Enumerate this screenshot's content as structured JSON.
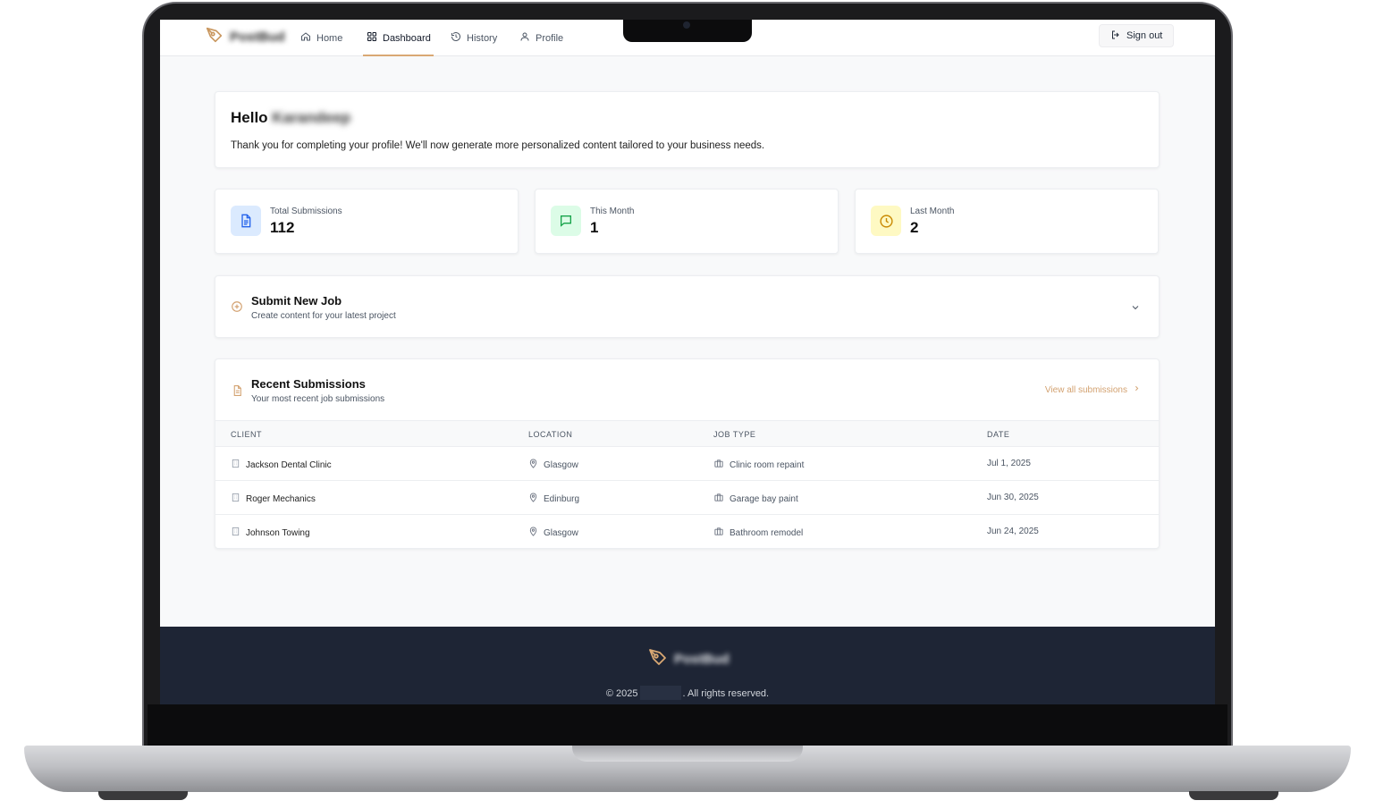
{
  "nav": {
    "brand": "PostBud",
    "items": [
      {
        "label": "Home",
        "icon": "home-icon"
      },
      {
        "label": "Dashboard",
        "icon": "grid-icon",
        "active": true
      },
      {
        "label": "History",
        "icon": "history-icon"
      },
      {
        "label": "Profile",
        "icon": "user-icon"
      }
    ],
    "sign_out": "Sign out"
  },
  "welcome": {
    "greeting": "Hello",
    "name": "Karandeep",
    "message": "Thank you for completing your profile! We'll now generate more personalized content tailored to your business needs."
  },
  "stats": [
    {
      "label": "Total Submissions",
      "value": "112",
      "icon": "document-icon",
      "color": "#2563eb",
      "bg": "#dbeafe"
    },
    {
      "label": "This Month",
      "value": "1",
      "icon": "message-icon",
      "color": "#16a34a",
      "bg": "#dcfce7"
    },
    {
      "label": "Last Month",
      "value": "2",
      "icon": "clock-icon",
      "color": "#ca8a04",
      "bg": "#fef9c3"
    }
  ],
  "submit_job": {
    "title": "Submit New Job",
    "subtitle": "Create content for your latest project"
  },
  "recent": {
    "title": "Recent Submissions",
    "subtitle": "Your most recent job submissions",
    "view_all": "View all submissions",
    "columns": [
      "CLIENT",
      "LOCATION",
      "JOB TYPE",
      "DATE"
    ],
    "rows": [
      {
        "client": "Jackson Dental Clinic",
        "location": "Glasgow",
        "job_type": "Clinic room repaint",
        "date": "Jul 1, 2025"
      },
      {
        "client": "Roger Mechanics",
        "location": "Edinburg",
        "job_type": "Garage bay paint",
        "date": "Jun 30, 2025"
      },
      {
        "client": "Johnson Towing",
        "location": "Glasgow",
        "job_type": "Bathroom remodel",
        "date": "Jun 24, 2025"
      }
    ]
  },
  "footer": {
    "brand": "PostBud",
    "copyright_prefix": "© 2025",
    "copyright_suffix": ". All rights reserved."
  },
  "colors": {
    "accent": "#d9a873",
    "footer_bg": "#1e2535"
  }
}
